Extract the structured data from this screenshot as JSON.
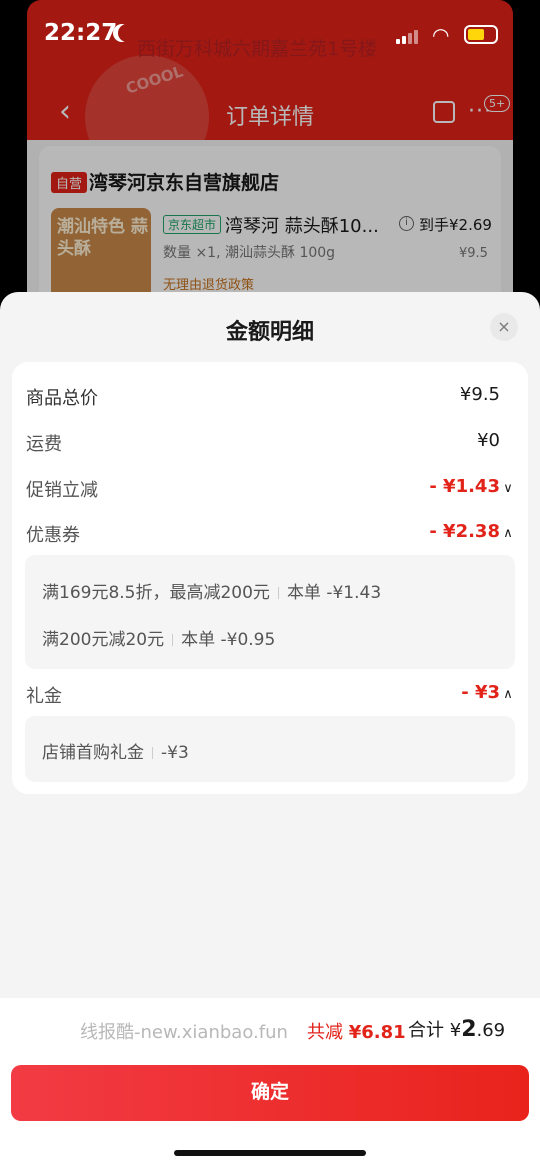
{
  "status_bar": {
    "time": "22:27"
  },
  "background_page": {
    "address": "西街万科城六期嘉兰苑1号楼",
    "nav_title": "订单详情",
    "more_badge": "5+",
    "store_tag": "自营",
    "store_name": "湾琴河京东自营旗舰店",
    "product_tag": "京东超市",
    "product_name": "湾琴河 蒜头酥10...",
    "final_price": "到手¥2.69",
    "spec": "数量 ×1, 潮汕蒜头酥 100g",
    "price": "¥9.5",
    "return_policy": "无理由退货政策",
    "thumb_text": "潮汕特色 蒜头酥"
  },
  "sheet": {
    "title": "金额明细",
    "close_label": "×",
    "rows": {
      "goods_total": {
        "label": "商品总价",
        "value": "¥9.5"
      },
      "shipping": {
        "label": "运费",
        "value": "¥0"
      },
      "promo": {
        "label": "促销立减",
        "value": "- ¥1.43"
      },
      "coupon": {
        "label": "优惠券",
        "value": "- ¥2.38"
      },
      "gift": {
        "label": "礼金",
        "value": "- ¥3"
      }
    },
    "coupon_details": [
      {
        "desc": "满169元8.5折，最高减200元",
        "amount": "本单 -¥1.43"
      },
      {
        "desc": "满200元减20元",
        "amount": "本单 -¥0.95"
      }
    ],
    "gift_details": [
      {
        "desc": "店铺首购礼金",
        "amount": "-¥3"
      }
    ]
  },
  "footer": {
    "watermark": "线报酷-new.xianbao.fun",
    "reduce_label": "共减",
    "reduce_value": "¥6.81",
    "total_label": "合计",
    "total_currency": "¥",
    "total_int": "2",
    "total_dec": ".69",
    "confirm_label": "确定"
  },
  "colors": {
    "brand_red": "#e2231a",
    "sheet_bg": "#f4f4f4"
  },
  "icons": [
    "back-icon",
    "share-icon",
    "more-icon",
    "info-icon",
    "close-icon",
    "chevron-down-icon",
    "chevron-up-icon"
  ]
}
